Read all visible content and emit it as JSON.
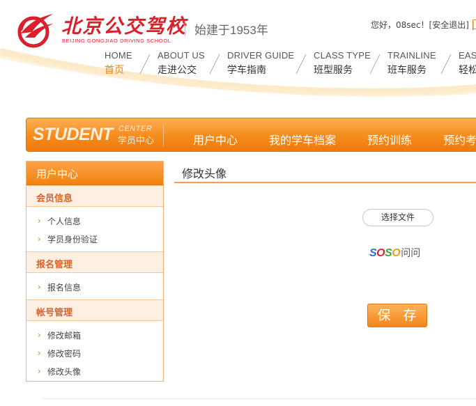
{
  "header": {
    "logo_cn": "北京公交驾校",
    "logo_en": "BEIJING GONGJIAO DRIVING SCHOOL",
    "since": "始建于1953年",
    "user_greeting": "您好，08sec！[",
    "logout_label": "安全退出",
    "user_suffix": "] |"
  },
  "topnav": [
    {
      "en": "HOME",
      "cn": "首页",
      "active": true
    },
    {
      "en": "ABOUT US",
      "cn": "走进公交"
    },
    {
      "en": "DRIVER GUIDE",
      "cn": "学车指南"
    },
    {
      "en": "CLASS TYPE",
      "cn": "班型服务"
    },
    {
      "en": "TRAINLINE",
      "cn": "班车服务"
    },
    {
      "en": "EASY",
      "cn": "轻松"
    }
  ],
  "mainbar": {
    "student": "STUDENT",
    "center_en": "CENTER",
    "center_cn": "学员中心",
    "items": [
      "用户中心",
      "我的学车档案",
      "预约训练",
      "预约考"
    ]
  },
  "sidebar": {
    "title": "用户中心",
    "groups": [
      {
        "title": "会员信息",
        "items": [
          "个人信息",
          "学员身份验证"
        ]
      },
      {
        "title": "报名管理",
        "items": [
          "报名信息"
        ]
      },
      {
        "title": "帐号管理",
        "items": [
          "修改邮箱",
          "修改密码",
          "修改头像"
        ]
      }
    ]
  },
  "content": {
    "title": "修改头像",
    "file_button": "选择文件",
    "soso_logo": {
      "s1": "S",
      "o1": "O",
      "s2": "S",
      "o2": "O",
      "wenwen": "问问"
    },
    "save_button": "保 存"
  },
  "colors": {
    "brand_red": "#d8212c",
    "accent_orange": "#f2820f",
    "soso_blue": "#2a6fc9",
    "soso_red": "#d8212c",
    "soso_green": "#3aa83a",
    "soso_orange": "#f39c1e"
  },
  "icons": {
    "logo": "bird-wing-logo",
    "list_arrow": "chevron-right-icon"
  }
}
